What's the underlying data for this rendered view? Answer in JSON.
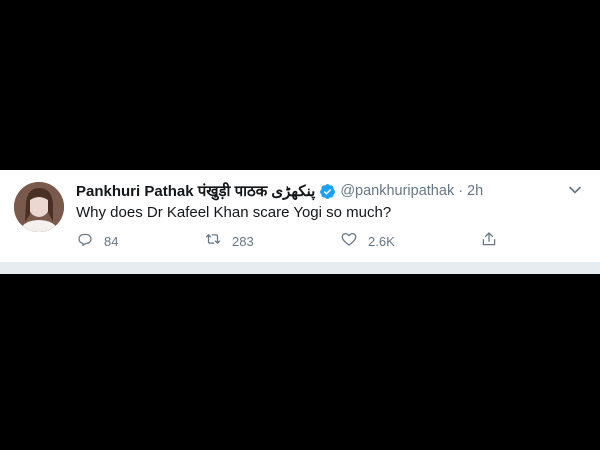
{
  "tweet": {
    "display_name": "Pankhuri Pathak पंखुड़ी पाठक پنکھڑی",
    "handle": "@pankhuripathak",
    "separator": "·",
    "time": "2h",
    "text": "Why does Dr Kafeel Khan scare Yogi so much?",
    "replies": "84",
    "retweets": "283",
    "likes": "2.6K",
    "verified": true
  },
  "icons": {
    "verified": "verified-badge-icon",
    "menu": "chevron-down-icon",
    "reply": "reply-icon",
    "retweet": "retweet-icon",
    "like": "heart-icon",
    "share": "share-icon"
  },
  "colors": {
    "background": "#000000",
    "card": "#ffffff",
    "verified": "#1da1f2",
    "secondary_text": "#657786",
    "primary_text": "#14171a",
    "divider": "#e6ecf0"
  }
}
